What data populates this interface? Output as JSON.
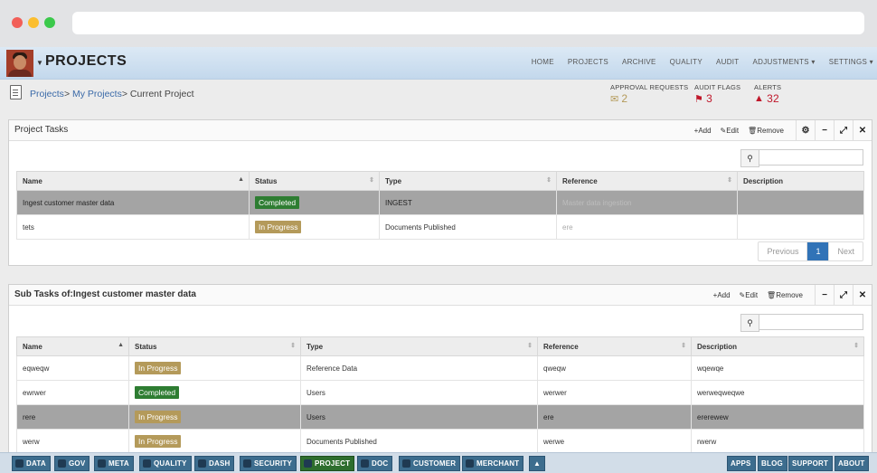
{
  "header": {
    "title": "PROJECTS",
    "nav": [
      "HOME",
      "PROJECTS",
      "ARCHIVE",
      "QUALITY",
      "AUDIT",
      "ADJUSTMENTS ▾",
      "SETTINGS ▾"
    ]
  },
  "breadcrumb": {
    "items": [
      "Projects",
      "My Projects",
      "Current Project"
    ],
    "separator": ">"
  },
  "stats": {
    "approval": {
      "label": "APPROVAL REQUESTS",
      "value": "2"
    },
    "flags": {
      "label": "AUDIT FLAGS",
      "value": "3"
    },
    "alerts": {
      "label": "ALERTS",
      "value": "32"
    }
  },
  "panel1": {
    "title": "Project Tasks",
    "actions": {
      "add": "+Add",
      "edit": "Edit",
      "remove": "Remove"
    },
    "columns": [
      "Name",
      "Status",
      "Type",
      "Reference",
      "Description"
    ],
    "rows": [
      {
        "name": "Ingest customer master data",
        "status": "Completed",
        "type": "INGEST",
        "reference": "Master data ingestion",
        "description": ""
      },
      {
        "name": "tets",
        "status": "In Progress",
        "type": "Documents Published",
        "reference": "ere",
        "description": ""
      }
    ],
    "pager": {
      "prev": "Previous",
      "page": "1",
      "next": "Next"
    }
  },
  "panel2": {
    "title": "Sub Tasks of:Ingest customer master data",
    "actions": {
      "add": "+Add",
      "edit": "Edit",
      "remove": "Remove"
    },
    "columns": [
      "Name",
      "Status",
      "Type",
      "Reference",
      "Description"
    ],
    "rows": [
      {
        "name": "eqweqw",
        "status": "In Progress",
        "type": "Reference Data",
        "reference": "qweqw",
        "description": "wqewqe"
      },
      {
        "name": "ewrwer",
        "status": "Completed",
        "type": "Users",
        "reference": "werwer",
        "description": "werweqweqwe"
      },
      {
        "name": "rere",
        "status": "In Progress",
        "type": "Users",
        "reference": "ere",
        "description": "ererewew"
      },
      {
        "name": "werw",
        "status": "In Progress",
        "type": "Documents Published",
        "reference": "werwe",
        "description": "rwerw"
      }
    ]
  },
  "taskbar": {
    "left": [
      "DATA",
      "GOV",
      "META",
      "QUALITY",
      "DASH",
      "SECURITY",
      "PROJECT",
      "DOC",
      "CUSTOMER",
      "MERCHANT"
    ],
    "up": "▲",
    "right": [
      "APPS",
      "BLOG",
      "SUPPORT",
      "ABOUT"
    ]
  },
  "colors": {
    "completed": "#2e7d32",
    "in_progress": "#b49a5a",
    "flag": "#c0182b",
    "accent": "#3173b7"
  }
}
